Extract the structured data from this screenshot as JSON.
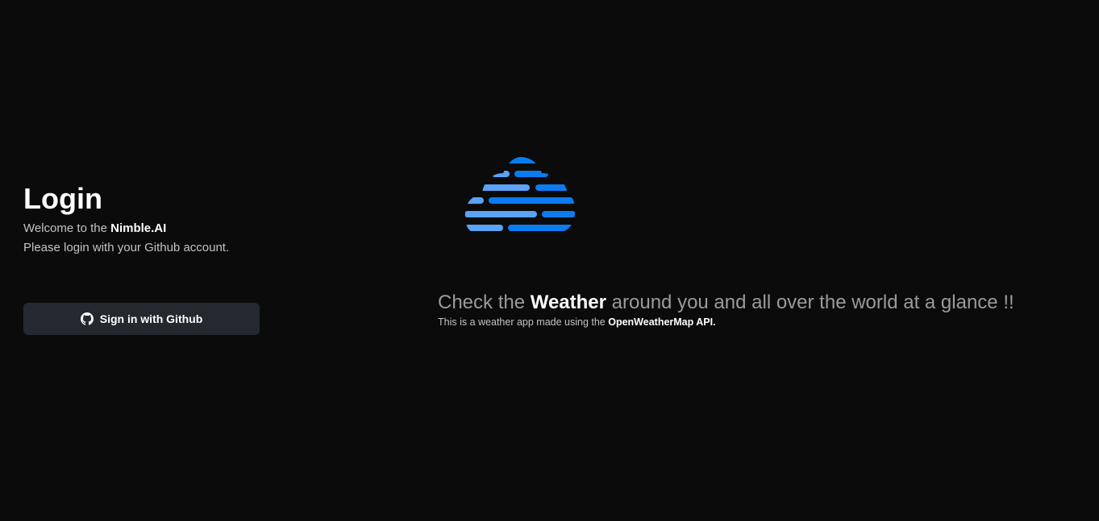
{
  "login": {
    "title": "Login",
    "welcome_prefix": "Welcome to the ",
    "brand_name": "Nimble.AI",
    "instruction": "Please login with your Github account.",
    "github_button_label": "Sign in with Github",
    "github_button_icon": "github-icon"
  },
  "hero": {
    "logo_icon": "weather-cloud-logo",
    "heading_prefix": "Check the ",
    "heading_strong": "Weather",
    "heading_suffix": " around you and all over the world at a glance !!",
    "sub_prefix": "This is a weather app made using the ",
    "sub_strong": "OpenWeatherMap API."
  },
  "colors": {
    "background": "#0b0b0c",
    "button_bg": "#24292f",
    "logo_blue": "#0a7cf0",
    "logo_light_blue": "#5aa3f5"
  }
}
